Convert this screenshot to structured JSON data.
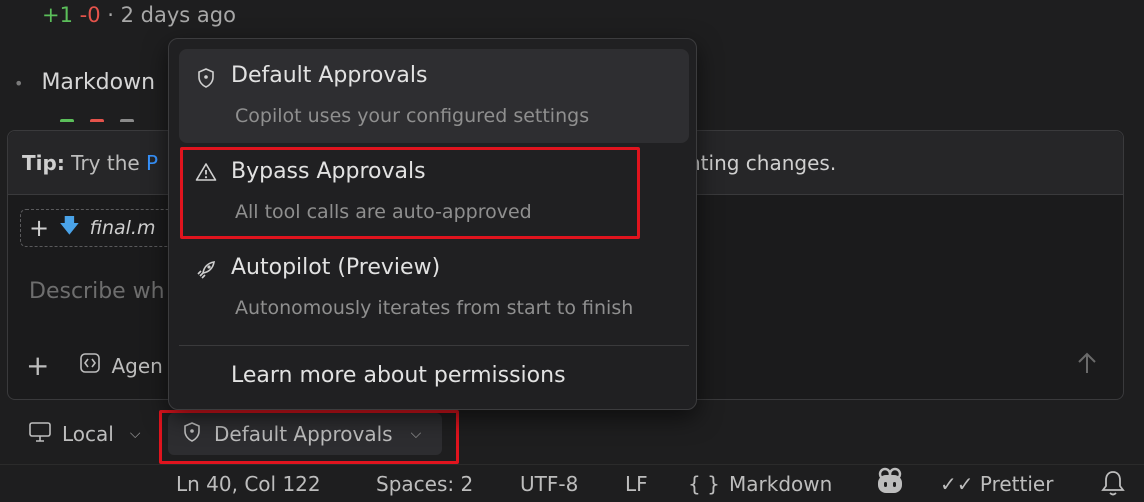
{
  "history": {
    "diff_add": "+1",
    "diff_del": "-0",
    "diff_sep": " · ",
    "diff_time": "2 days ago",
    "bullet_label": "Markdown"
  },
  "tip": {
    "label": "Tip:",
    "text_start": " Try the ",
    "link": "P",
    "text_end": "nting changes."
  },
  "attachment": {
    "filename": "final.m"
  },
  "input": {
    "placeholder": "Describe wh"
  },
  "toolbar": {
    "agent_label": "Agen"
  },
  "session": {
    "local_label": "Local",
    "approvals_label": "Default Approvals"
  },
  "menu": {
    "items": [
      {
        "title": "Default Approvals",
        "desc": "Copilot uses your configured settings",
        "icon": "shield-icon",
        "selected": true
      },
      {
        "title": "Bypass Approvals",
        "desc": "All tool calls are auto-approved",
        "icon": "warning-icon",
        "selected": false
      },
      {
        "title": "Autopilot (Preview)",
        "desc": "Autonomously iterates from start to finish",
        "icon": "rocket-icon",
        "selected": false
      }
    ],
    "learn_more": "Learn more about permissions"
  },
  "statusbar": {
    "position": "Ln 40, Col 122",
    "spaces": "Spaces: 2",
    "encoding": "UTF-8",
    "eol": "LF",
    "language_braces": "{ }",
    "language": "Markdown",
    "formatter": "Prettier"
  },
  "colors": {
    "highlight_frame": "#e0141e",
    "link": "#3794ff",
    "diff_add": "#5bbf5a",
    "diff_del": "#e5534b"
  }
}
